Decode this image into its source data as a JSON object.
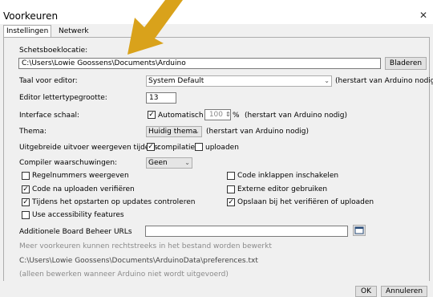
{
  "window": {
    "title": "Voorkeuren",
    "close_glyph": "✕"
  },
  "tabs": [
    {
      "label": "Instellingen"
    },
    {
      "label": "Netwerk"
    }
  ],
  "sketchbook": {
    "label": "Schetsboeklocatie:",
    "path": "C:\\Users\\Lowie Goossens\\Documents\\Arduino",
    "browse_label": "Bladeren"
  },
  "language": {
    "label": "Taal voor editor:",
    "value": "System Default",
    "note": "(herstart van Arduino nodig)"
  },
  "font_size": {
    "label": "Editor lettertypegrootte:",
    "value": "13"
  },
  "interface_scale": {
    "label": "Interface schaal:",
    "auto_label": "Automatisch",
    "auto_checked": true,
    "value": "100",
    "unit": "%",
    "note": "(herstart van Arduino nodig)"
  },
  "theme": {
    "label": "Thema:",
    "value": "Huidig thema",
    "note": "(herstart van Arduino nodig)"
  },
  "verbose": {
    "label": "Uitgebreide uitvoer weergeven tijdens:",
    "compile_label": "compilatie",
    "compile_checked": true,
    "upload_label": "uploaden",
    "upload_checked": false
  },
  "compiler_warnings": {
    "label": "Compiler waarschuwingen:",
    "value": "Geen"
  },
  "options_left": [
    {
      "label": "Regelnummers weergeven",
      "checked": false
    },
    {
      "label": "Code na uploaden verifiëren",
      "checked": true
    },
    {
      "label": "Tijdens het opstarten op updates controleren",
      "checked": true
    },
    {
      "label": "Use accessibility features",
      "checked": false
    }
  ],
  "options_right": [
    {
      "label": "Code inklappen inschakelen",
      "checked": false
    },
    {
      "label": "Externe editor gebruiken",
      "checked": false
    },
    {
      "label": "Opslaan bij het verifiëren of uploaden",
      "checked": true
    }
  ],
  "board_urls": {
    "label": "Additionele Board Beheer URLs",
    "value": ""
  },
  "info": {
    "line1": "Meer voorkeuren kunnen rechtstreeks in het bestand worden bewerkt",
    "path": "C:\\Users\\Lowie Goossens\\Documents\\ArduinoData\\preferences.txt",
    "line3": "(alleen bewerken wanneer Arduino niet wordt uitgevoerd)"
  },
  "buttons": {
    "ok": "OK",
    "cancel": "Annuleren"
  },
  "colors": {
    "accent_arrow": "#d9a21b"
  },
  "icons": {
    "check": "✓",
    "chevron": "⌄",
    "spin": "⇕"
  }
}
